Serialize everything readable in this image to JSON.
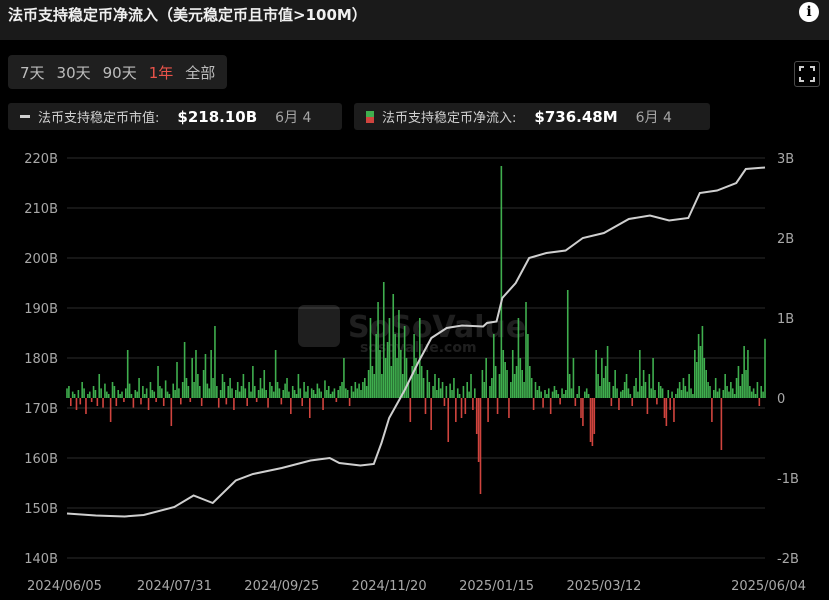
{
  "header": {
    "title": "法币支持稳定币净流入（美元稳定币且市值>100M）",
    "info_icon": "info-icon"
  },
  "range_tabs": [
    {
      "label": "7天",
      "active": false
    },
    {
      "label": "30天",
      "active": false
    },
    {
      "label": "90天",
      "active": false
    },
    {
      "label": "1年",
      "active": true
    },
    {
      "label": "全部",
      "active": false
    }
  ],
  "legend": {
    "market_cap": {
      "label": "法币支持稳定币市值:",
      "value": "$218.10B",
      "date": "6月 4"
    },
    "net_inflow": {
      "label": "法币支持稳定币净流入:",
      "value": "$736.48M",
      "date": "6月 4"
    }
  },
  "watermark": {
    "brand": "SoSoValue",
    "url": "sosovalue.com"
  },
  "colors": {
    "line": "#cfcfcf",
    "positive": "#3fae4e",
    "negative": "#d0443e",
    "grid": "#2c2c2c",
    "background": "#000000",
    "active_tab": "#e8534a"
  },
  "chart_data": {
    "type": "bar+line",
    "x_tick_labels": [
      "2024/06/05",
      "2024/07/31",
      "2024/09/25",
      "2024/11/20",
      "2025/01/15",
      "2025/03/12",
      "2025/06/04"
    ],
    "y_left": {
      "ticks": [
        "140B",
        "150B",
        "160B",
        "170B",
        "180B",
        "190B",
        "200B",
        "210B",
        "220B"
      ],
      "range": [
        140,
        220
      ],
      "unit": "B"
    },
    "y_right": {
      "ticks": [
        "-2B",
        "-1B",
        "0",
        "1B",
        "2B",
        "3B"
      ],
      "range": [
        -2,
        3
      ],
      "unit": "B"
    },
    "series": [
      {
        "name": "法币支持稳定币市值",
        "kind": "line",
        "axis": "left",
        "points": [
          [
            "2024/06/05",
            148.9
          ],
          [
            "2024/06/20",
            148.5
          ],
          [
            "2024/07/05",
            148.3
          ],
          [
            "2024/07/15",
            148.6
          ],
          [
            "2024/07/31",
            150.2
          ],
          [
            "2024/08/10",
            152.5
          ],
          [
            "2024/08/20",
            151.0
          ],
          [
            "2024/09/01",
            155.5
          ],
          [
            "2024/09/10",
            156.8
          ],
          [
            "2024/09/25",
            158.0
          ],
          [
            "2024/10/10",
            159.5
          ],
          [
            "2024/10/20",
            160.0
          ],
          [
            "2024/10/25",
            159.0
          ],
          [
            "2024/11/05",
            158.5
          ],
          [
            "2024/11/12",
            158.8
          ],
          [
            "2024/11/16",
            163.0
          ],
          [
            "2024/11/20",
            168.0
          ],
          [
            "2024/11/28",
            173.5
          ],
          [
            "2024/12/05",
            179.0
          ],
          [
            "2024/12/12",
            184.0
          ],
          [
            "2024/12/20",
            186.0
          ],
          [
            "2024/12/28",
            186.5
          ],
          [
            "2025/01/08",
            186.3
          ],
          [
            "2025/01/10",
            187.0
          ],
          [
            "2025/01/15",
            187.3
          ],
          [
            "2025/01/18",
            192.0
          ],
          [
            "2025/01/25",
            195.0
          ],
          [
            "2025/02/01",
            200.0
          ],
          [
            "2025/02/10",
            201.0
          ],
          [
            "2025/02/20",
            201.5
          ],
          [
            "2025/03/01",
            204.0
          ],
          [
            "2025/03/12",
            205.0
          ],
          [
            "2025/03/25",
            207.8
          ],
          [
            "2025/04/05",
            208.5
          ],
          [
            "2025/04/15",
            207.5
          ],
          [
            "2025/04/25",
            208.0
          ],
          [
            "2025/05/01",
            213.0
          ],
          [
            "2025/05/10",
            213.5
          ],
          [
            "2025/05/20",
            215.0
          ],
          [
            "2025/05/25",
            217.8
          ],
          [
            "2025/06/04",
            218.1
          ]
        ]
      },
      {
        "name": "法币支持稳定币净流入",
        "kind": "bar",
        "axis": "right",
        "start": "2024/06/05",
        "end": "2025/06/04",
        "daily_values_B": [
          0.12,
          0.15,
          -0.1,
          0.08,
          0.05,
          -0.15,
          0.1,
          -0.08,
          0.2,
          0.12,
          -0.2,
          0.05,
          0.08,
          -0.05,
          0.15,
          0.1,
          -0.1,
          0.3,
          0.12,
          -0.12,
          0.18,
          0.08,
          0.05,
          -0.3,
          0.2,
          0.15,
          -0.1,
          0.1,
          0.05,
          0.08,
          -0.05,
          0.12,
          0.6,
          0.18,
          0.05,
          -0.12,
          0.1,
          0.08,
          0.25,
          -0.08,
          0.15,
          0.05,
          0.12,
          -0.15,
          0.2,
          0.1,
          0.08,
          -0.05,
          0.4,
          0.15,
          0.12,
          -0.1,
          0.22,
          0.08,
          0.05,
          -0.35,
          0.18,
          0.1,
          0.45,
          0.12,
          -0.08,
          0.2,
          0.7,
          0.25,
          0.15,
          -0.05,
          0.5,
          0.2,
          0.6,
          0.3,
          0.15,
          -0.1,
          0.35,
          0.55,
          0.18,
          0.12,
          0.6,
          0.25,
          0.9,
          0.15,
          -0.12,
          0.1,
          0.3,
          0.2,
          -0.08,
          0.15,
          0.25,
          0.12,
          -0.15,
          0.1,
          0.2,
          0.08,
          0.15,
          0.3,
          0.12,
          -0.1,
          0.2,
          0.08,
          0.4,
          0.15,
          -0.05,
          0.1,
          0.25,
          0.12,
          0.35,
          0.1,
          -0.12,
          0.2,
          0.15,
          0.08,
          0.6,
          0.2,
          0.12,
          -0.08,
          0.1,
          0.18,
          0.25,
          0.08,
          -0.2,
          0.15,
          0.1,
          0.05,
          0.3,
          0.12,
          -0.1,
          0.2,
          0.08,
          0.15,
          -0.25,
          0.12,
          0.1,
          0.05,
          0.18,
          0.12,
          0.08,
          -0.15,
          0.22,
          0.1,
          0.15,
          0.05,
          0.08,
          0.12,
          -0.05,
          0.1,
          0.15,
          0.2,
          0.5,
          0.12,
          0.1,
          -0.1,
          0.15,
          0.08,
          0.2,
          0.12,
          0.18,
          0.1,
          0.2,
          0.25,
          0.15,
          0.35,
          1.0,
          0.4,
          0.3,
          0.8,
          1.2,
          0.6,
          0.3,
          1.45,
          0.5,
          0.7,
          1.0,
          0.4,
          1.3,
          0.8,
          0.5,
          1.1,
          0.6,
          0.3,
          0.9,
          0.5,
          0.2,
          -0.3,
          0.4,
          0.8,
          0.5,
          0.3,
          1.0,
          0.4,
          0.25,
          -0.2,
          0.35,
          0.2,
          -0.4,
          0.15,
          0.3,
          0.1,
          0.25,
          0.12,
          0.2,
          -0.1,
          0.15,
          -0.55,
          0.18,
          0.1,
          0.25,
          -0.3,
          0.12,
          0.05,
          -0.25,
          0.15,
          -0.2,
          0.2,
          0.08,
          0.3,
          -0.15,
          0.12,
          -0.45,
          -0.8,
          -1.2,
          0.35,
          0.2,
          0.5,
          -0.3,
          0.15,
          0.25,
          0.8,
          0.4,
          -0.2,
          0.3,
          2.9,
          0.6,
          0.45,
          0.35,
          -0.25,
          0.2,
          0.6,
          0.3,
          0.4,
          1.0,
          0.5,
          0.35,
          0.2,
          1.2,
          0.8,
          0.4,
          0.25,
          -0.15,
          0.2,
          0.1,
          0.15,
          0.08,
          -0.12,
          0.1,
          0.05,
          0.12,
          -0.2,
          0.08,
          0.15,
          0.1,
          0.05,
          -0.08,
          0.12,
          0.05,
          0.1,
          1.35,
          0.3,
          0.12,
          0.5,
          -0.1,
          0.05,
          0.15,
          -0.25,
          -0.35,
          0.08,
          0.12,
          0.05,
          -0.55,
          -0.6,
          -0.45,
          0.6,
          0.3,
          0.15,
          0.5,
          0.25,
          0.4,
          0.65,
          0.2,
          -0.1,
          0.15,
          0.35,
          0.12,
          -0.15,
          0.08,
          0.1,
          0.2,
          0.3,
          0.12,
          0.05,
          -0.1,
          0.15,
          0.25,
          0.08,
          0.6,
          0.15,
          0.35,
          0.2,
          -0.2,
          0.3,
          0.12,
          0.5,
          0.1,
          -0.08,
          0.2,
          0.15,
          0.12,
          -0.25,
          -0.35,
          0.1,
          -0.15,
          0.08,
          -0.3,
          0.05,
          0.12,
          0.2,
          0.1,
          0.25,
          0.15,
          0.08,
          0.3,
          0.12,
          0.05,
          0.6,
          0.45,
          0.8,
          0.65,
          0.9,
          0.5,
          0.35,
          0.2,
          0.15,
          -0.3,
          0.1,
          0.25,
          0.08,
          0.12,
          -0.65,
          0.1,
          0.3,
          0.15,
          0.08,
          0.2,
          0.12,
          0.05,
          0.25,
          0.4,
          0.15,
          0.3,
          0.65,
          0.35,
          0.6,
          0.15,
          0.08,
          0.12,
          0.05,
          0.2,
          -0.1,
          0.15,
          0.08,
          0.74
        ]
      }
    ]
  }
}
